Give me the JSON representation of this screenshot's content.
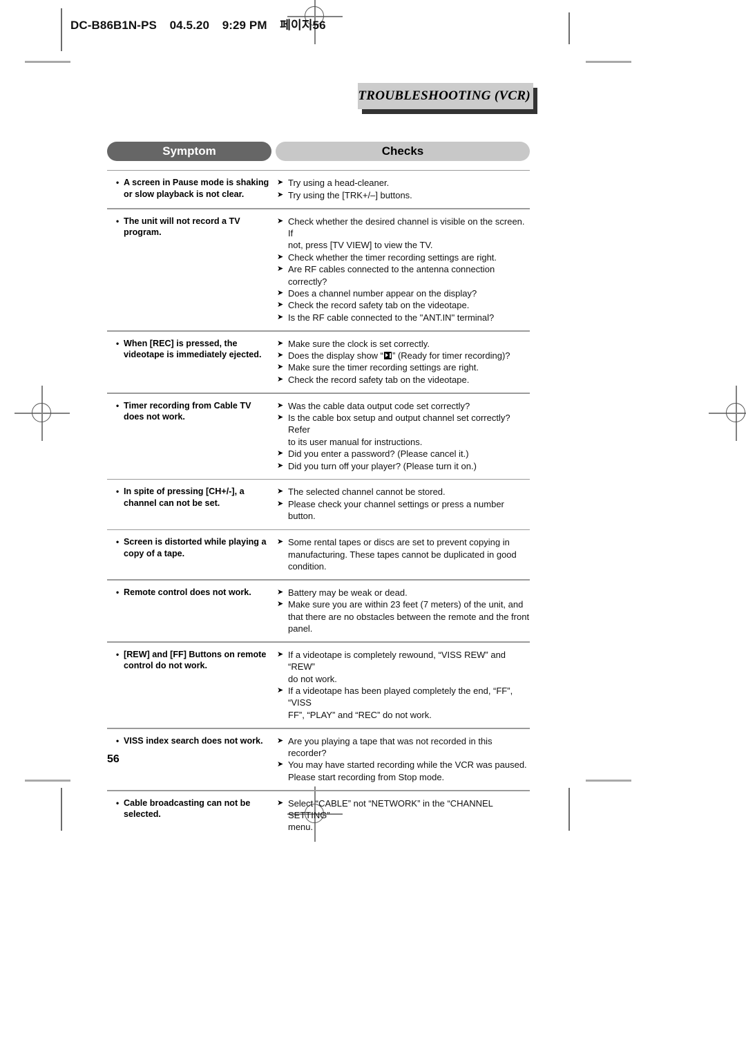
{
  "page_header": {
    "file_id": "DC-B86B1N-PS",
    "date": "04.5.20",
    "time": "9:29 PM",
    "page_label": "페이지56"
  },
  "section_title": "TROUBLESHOOTING (VCR)",
  "page_number": "56",
  "table": {
    "headers": {
      "symptom": "Symptom",
      "checks": "Checks"
    },
    "bullet_symbol": "•",
    "arrow_symbol": "➤",
    "rows": [
      {
        "symptom": [
          "A screen in Pause mode is shaking",
          "or slow playback is not clear."
        ],
        "checks": [
          [
            "Try using a head-cleaner."
          ],
          [
            "Try using the [TRK+/–] buttons."
          ]
        ]
      },
      {
        "symptom": [
          "The unit will not record a TV",
          "program."
        ],
        "checks": [
          [
            "Check whether the desired channel is visible on the screen. If",
            "not, press [TV VIEW] to view the TV."
          ],
          [
            "Check whether the timer recording settings are right."
          ],
          [
            "Are RF cables connected to the antenna connection correctly?"
          ],
          [
            "Does a channel number appear on the display?"
          ],
          [
            "Check the record safety tab on the videotape."
          ],
          [
            "Is the RF cable connected to the \"ANT.IN\" terminal?"
          ]
        ]
      },
      {
        "symptom": [
          "When [REC] is pressed, the",
          "videotape is immediately ejected."
        ],
        "checks": [
          [
            "Make sure the clock is set correctly."
          ],
          [
            "Does the display show “",
            "” (Ready for timer recording)?"
          ],
          [
            "Make sure the timer recording settings are right."
          ],
          [
            "Check the record safety tab on the videotape."
          ]
        ],
        "has_timer_glyph": true
      },
      {
        "symptom": [
          "Timer recording from Cable TV",
          "does not work."
        ],
        "checks": [
          [
            "Was the cable data output code set correctly?"
          ],
          [
            "Is the cable box setup and output channel set correctly? Refer",
            "to its user manual for instructions."
          ],
          [
            "Did you enter a password? (Please cancel it.)"
          ],
          [
            "Did you turn off your player? (Please turn it on.)"
          ]
        ]
      },
      {
        "symptom": [
          "In spite of pressing [CH+/-], a",
          "channel can not be set."
        ],
        "checks": [
          [
            "The selected channel cannot be stored."
          ],
          [
            "Please check your channel settings or press a number button."
          ]
        ]
      },
      {
        "symptom": [
          "Screen is distorted while playing a",
          "copy of a tape."
        ],
        "checks": [
          [
            "Some rental tapes or discs are set to prevent copying in",
            "manufacturing. These tapes cannot be duplicated in good",
            "condition."
          ]
        ]
      },
      {
        "symptom": [
          "Remote control does not work."
        ],
        "checks": [
          [
            "Battery may be weak or dead."
          ],
          [
            "Make sure you are within 23 feet (7 meters) of the unit, and",
            "that there are no obstacles between the remote and the front",
            "panel."
          ]
        ]
      },
      {
        "symptom": [
          "[REW] and [FF] Buttons on remote",
          "control do not work."
        ],
        "checks": [
          [
            "If a videotape is completely rewound, “VISS REW” and “REW”",
            "do not work."
          ],
          [
            "If a videotape has been played completely the end, “FF”, “VISS",
            "FF”, “PLAY” and “REC” do not work."
          ]
        ]
      },
      {
        "symptom": [
          "VISS index search does not work."
        ],
        "checks": [
          [
            "Are you playing a tape that was not recorded in this recorder?"
          ],
          [
            "You may have started recording while the VCR was paused.",
            "Please start recording from Stop mode."
          ]
        ]
      },
      {
        "symptom": [
          "Cable broadcasting can not be",
          "selected."
        ],
        "checks": [
          [
            "Select “CABLE” not “NETWORK” in the “CHANNEL SETTING”",
            "menu."
          ]
        ]
      }
    ]
  }
}
